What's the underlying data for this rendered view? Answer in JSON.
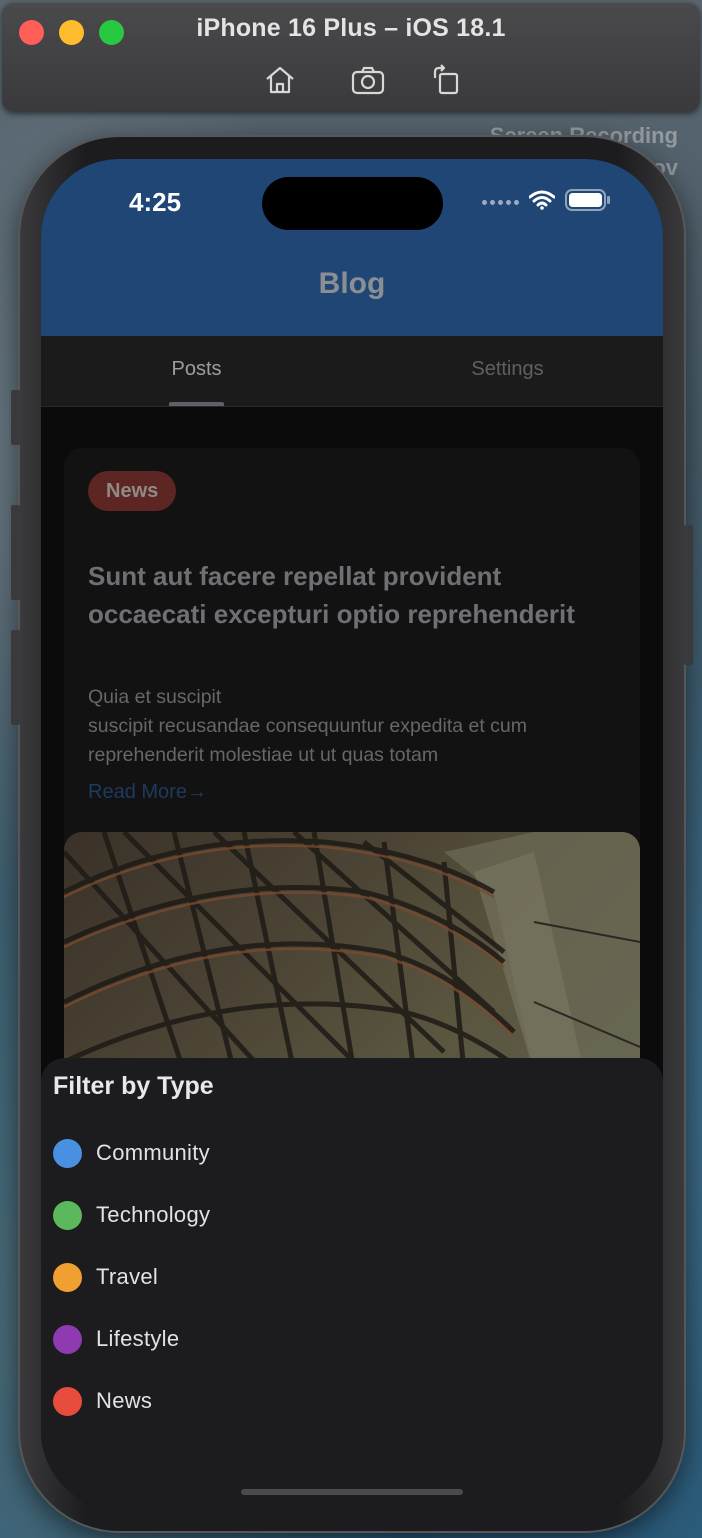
{
  "simulator": {
    "title": "iPhone 16 Plus – iOS 18.1",
    "toolbar": [
      "home-icon",
      "screenshot-icon",
      "rotate-icon"
    ],
    "overlay_label_line1": "Screen Recording",
    "overlay_label_line2": "ov"
  },
  "status_bar": {
    "time": "4:25"
  },
  "header": {
    "title": "Blog",
    "color": "#1f4675"
  },
  "tabs": [
    {
      "label": "Posts",
      "selected": true
    },
    {
      "label": "Settings",
      "selected": false
    }
  ],
  "post": {
    "badge": "News",
    "title": "Sunt aut facere repellat provident occaecati excepturi optio reprehenderit",
    "excerpt": "Quia et suscipit\nsuscipit recusandae consequuntur expedita et cum reprehenderit molestiae ut ut quas totam",
    "read_more": "Read More",
    "arrow": "→"
  },
  "filter_sheet": {
    "title": "Filter by Type",
    "items": [
      {
        "label": "Community",
        "color": "#4a90e2"
      },
      {
        "label": "Technology",
        "color": "#5cb85c"
      },
      {
        "label": "Travel",
        "color": "#f0a030"
      },
      {
        "label": "Lifestyle",
        "color": "#8e3ab0"
      },
      {
        "label": "News",
        "color": "#e74c3c"
      }
    ]
  }
}
